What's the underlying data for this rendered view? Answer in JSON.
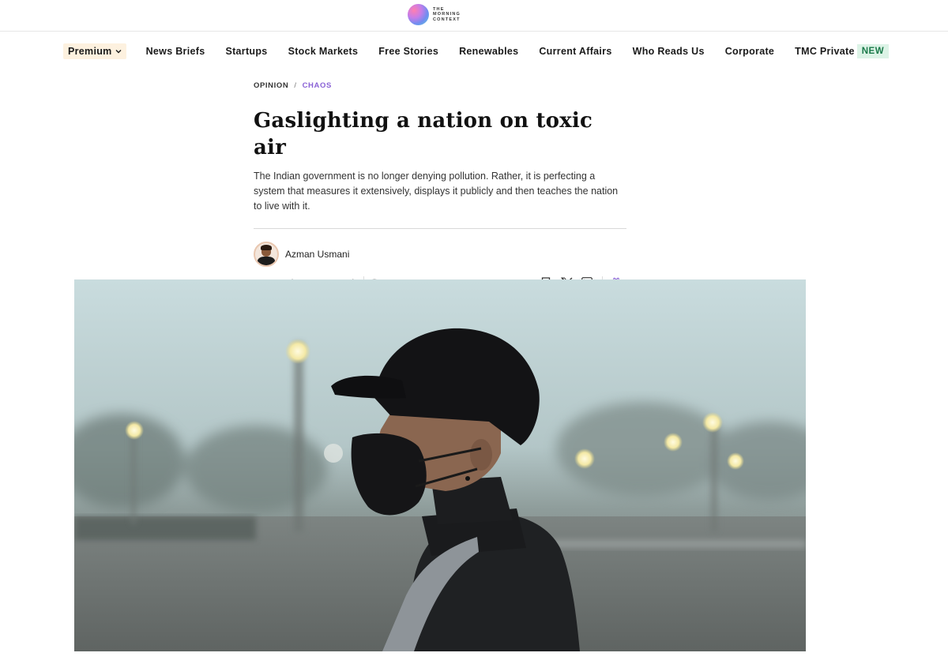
{
  "brand": {
    "logo_lines": [
      "THE",
      "MORNING",
      "CONTEXT"
    ]
  },
  "nav": {
    "premium_label": "Premium",
    "items": [
      "News Briefs",
      "Startups",
      "Stock Markets",
      "Free Stories",
      "Renewables",
      "Current Affairs",
      "Who Reads Us",
      "Corporate",
      "TMC Private"
    ],
    "new_badge": "NEW"
  },
  "article": {
    "section": "OPINION",
    "separator": "/",
    "tag": "CHAOS",
    "title": "Gaslighting a nation on toxic air",
    "dek": "The Indian government is no longer denying pollution. Rather, it is perfecting a system that measures it extensively, displays it publicly and then teaches the nation to live with it.",
    "author": "Azman Usmani",
    "date": "17 December, 2025",
    "dot": "•",
    "read_time": "8 min",
    "comment_count": "0"
  },
  "icons": {
    "dropdown": "chevron-down-icon",
    "comment": "comment-icon",
    "bookmark": "bookmark-icon",
    "x": "x-twitter-icon",
    "linkedin": "linkedin-icon",
    "gift": "gift-icon"
  },
  "colors": {
    "accent_purple": "#8a62d6",
    "premium_bg": "#fdf1df",
    "new_bg": "#dcf3e6",
    "new_text": "#1a7a4a"
  }
}
